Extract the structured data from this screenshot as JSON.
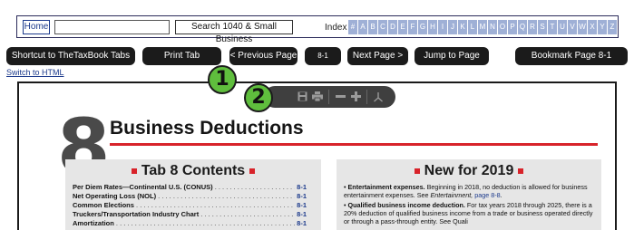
{
  "topbar": {
    "home_label": "Home",
    "search_value": "",
    "search_button": "Search 1040 & Small Business",
    "index_label": "Index",
    "index_letters": [
      "#",
      "A",
      "B",
      "C",
      "D",
      "E",
      "F",
      "G",
      "H",
      "I",
      "J",
      "K",
      "L",
      "M",
      "N",
      "O",
      "P",
      "Q",
      "R",
      "S",
      "T",
      "U",
      "V",
      "W",
      "X",
      "Y",
      "Z"
    ]
  },
  "nav": {
    "shortcut": "Shortcut to TheTaxBook Tabs",
    "print_tab": "Print Tab",
    "previous_page": "< Previous Page",
    "page_number": "8-1",
    "next_page": "Next Page >",
    "jump_to_page": "Jump to Page",
    "bookmark": "Bookmark Page 8-1",
    "switch_html": "Switch to HTML"
  },
  "badges": {
    "one": "1",
    "two": "2"
  },
  "viewer_toolbar": {
    "icons": [
      "save-icon",
      "print-icon",
      "zoom-out-icon",
      "zoom-in-icon",
      "acrobat-icon"
    ]
  },
  "page": {
    "chapter_number": "8",
    "heading": "Business Deductions",
    "accent_color": "#d8232a",
    "toc": {
      "title": "Tab 8 Contents",
      "rows": [
        {
          "label": "Per Diem Rates—Continental U.S. (CONUS)",
          "page": "8-1"
        },
        {
          "label": "Net Operating Loss (NOL)",
          "page": "8-1"
        },
        {
          "label": "Common Elections",
          "page": "8-1"
        },
        {
          "label": "Truckers/Transportation Industry Chart",
          "page": "8-1"
        },
        {
          "label": "Amortization",
          "page": "8-1"
        }
      ]
    },
    "new_for": {
      "title": "New for 2019",
      "item1_bold": "Entertainment expenses.",
      "item1_text": " Beginning in 2018, no deduction is allowed for business entertainment expenses. See ",
      "item1_italic": "Entertainment,",
      "item1_link": " page 8-8",
      "item1_end": ".",
      "item2_bold": "Qualified business income deduction.",
      "item2_text": " For tax years 2018 through 2025, there is a 20% deduction of qualified business income from a trade or business operated directly or through a pass-through entity. See Quali"
    }
  }
}
